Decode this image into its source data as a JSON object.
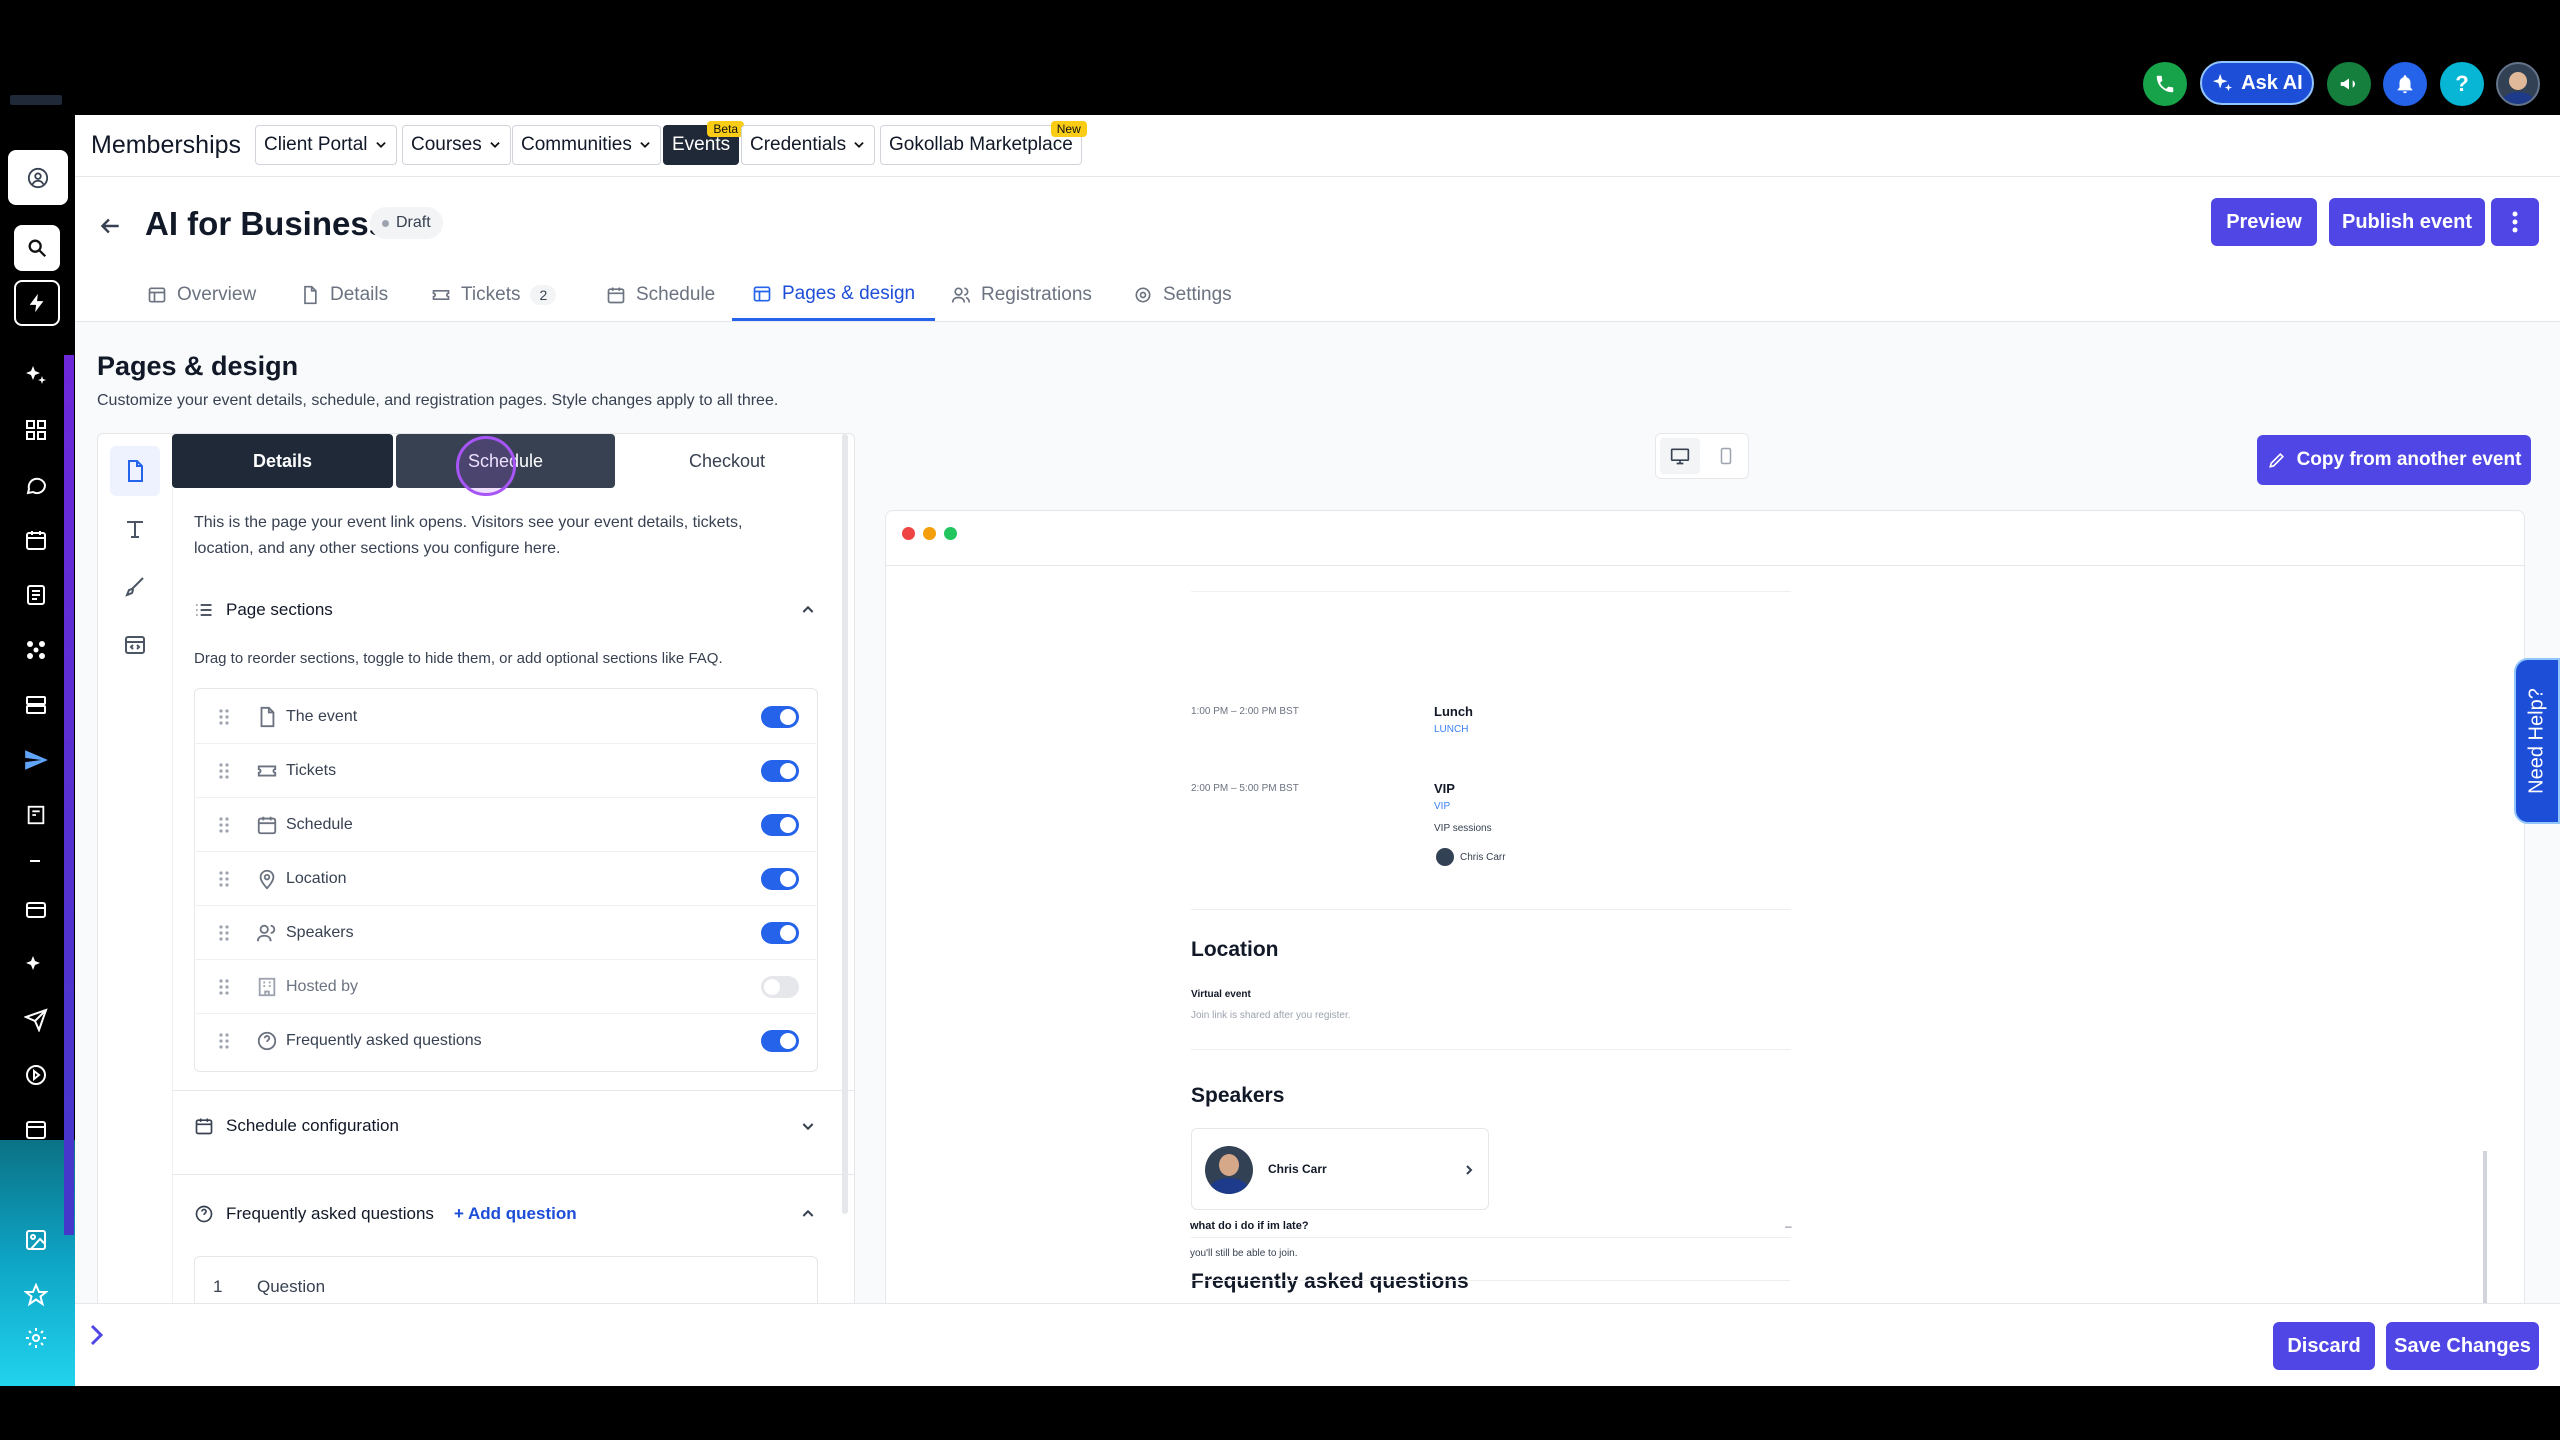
{
  "topbar": {
    "ask_ai_label": "Ask AI",
    "help_label": "?"
  },
  "subnav": {
    "title": "Memberships",
    "items": [
      {
        "label": "Client Portal",
        "dropdown": true
      },
      {
        "label": "Courses",
        "dropdown": true
      },
      {
        "label": "Communities",
        "dropdown": true
      },
      {
        "label": "Events",
        "dropdown": false,
        "active": true,
        "badge": "Beta"
      },
      {
        "label": "Credentials",
        "dropdown": true
      },
      {
        "label": "Gokollab Marketplace",
        "dropdown": false,
        "badge": "New"
      }
    ]
  },
  "header": {
    "title": "AI for Business",
    "status": "Draft",
    "preview_label": "Preview",
    "publish_label": "Publish event",
    "tabs": [
      {
        "label": "Overview",
        "icon": "layout-icon"
      },
      {
        "label": "Details",
        "icon": "document-icon"
      },
      {
        "label": "Tickets",
        "icon": "ticket-icon",
        "count": "2"
      },
      {
        "label": "Schedule",
        "icon": "calendar-icon"
      },
      {
        "label": "Pages & design",
        "icon": "layout-icon",
        "active": true
      },
      {
        "label": "Registrations",
        "icon": "users-icon"
      },
      {
        "label": "Settings",
        "icon": "gear-icon"
      }
    ]
  },
  "page": {
    "title": "Pages & design",
    "subtitle": "Customize your event details, schedule, and registration pages. Style changes apply to all three."
  },
  "editor": {
    "segments": [
      "Details",
      "Schedule",
      "Checkout"
    ],
    "intro": "This is the page your event link opens. Visitors see your event details, tickets, location, and any other sections you configure here.",
    "page_sections_title": "Page sections",
    "page_sections_hint": "Drag to reorder sections, toggle to hide them, or add optional sections like FAQ.",
    "sections": [
      {
        "label": "The event",
        "icon": "document-icon",
        "enabled": true
      },
      {
        "label": "Tickets",
        "icon": "ticket-icon",
        "enabled": true
      },
      {
        "label": "Schedule",
        "icon": "calendar-icon",
        "enabled": true
      },
      {
        "label": "Location",
        "icon": "pin-icon",
        "enabled": true
      },
      {
        "label": "Speakers",
        "icon": "users-icon",
        "enabled": true
      },
      {
        "label": "Hosted by",
        "icon": "building-icon",
        "enabled": false
      },
      {
        "label": "Frequently asked questions",
        "icon": "question-icon",
        "enabled": true
      }
    ],
    "schedule_config_title": "Schedule configuration",
    "faq_title": "Frequently asked questions",
    "add_question_label": "+ Add question",
    "question_number": "1",
    "question_label": "Question"
  },
  "preview": {
    "copy_label": "Copy from another event",
    "schedule": [
      {
        "time": "1:00 PM – 2:00 PM BST",
        "title": "Lunch",
        "tag": "LUNCH"
      },
      {
        "time": "2:00 PM – 5:00 PM BST",
        "title": "VIP",
        "tag": "VIP",
        "description": "VIP sessions",
        "speaker": "Chris Carr"
      }
    ],
    "location_heading": "Location",
    "location_type": "Virtual event",
    "location_note": "Join link is shared after you register.",
    "speakers_heading": "Speakers",
    "speaker_name": "Chris Carr",
    "faq_heading": "Frequently asked questions",
    "faq_question": "what do i do if im late?",
    "faq_answer": "you'll still be able to join.",
    "faq_toggle": "–"
  },
  "footer": {
    "discard_label": "Discard",
    "save_label": "Save Changes"
  },
  "help_tab": "Need Help?",
  "colors": {
    "accent": "#4f46e5",
    "tab_active": "#2563eb",
    "toggle_on": "#2563eb"
  }
}
